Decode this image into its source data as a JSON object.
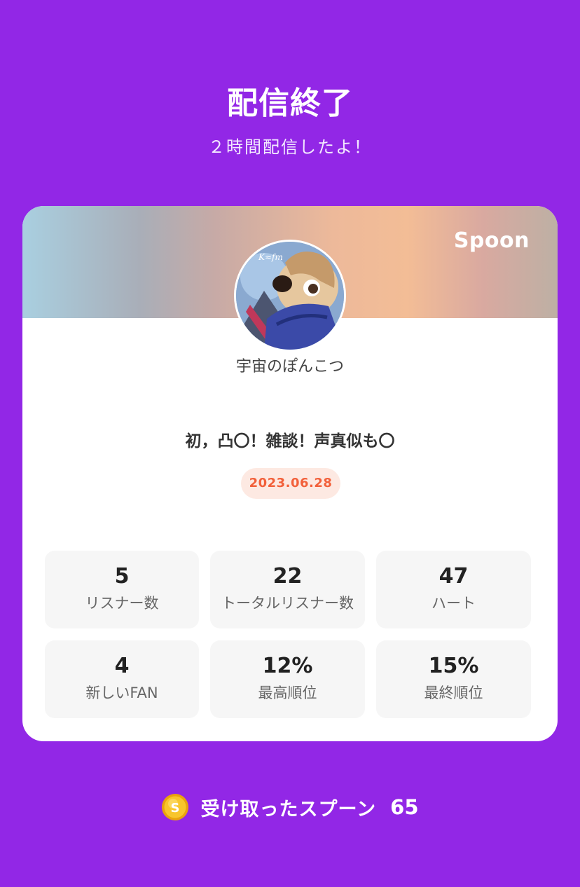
{
  "header": {
    "title": "配信終了",
    "subtitle": "２時間配信したよ！"
  },
  "card": {
    "brand": "Spoon",
    "username": "宇宙のぽんこつ",
    "stream_title": "初，凸〇！雑談！声真似も〇",
    "date": "2023.06.28",
    "stats": [
      {
        "value": "5",
        "label": "リスナー数"
      },
      {
        "value": "22",
        "label": "トータルリスナー数"
      },
      {
        "value": "47",
        "label": "ハート"
      },
      {
        "value": "4",
        "label": "新しいFAN"
      },
      {
        "value": "12%",
        "label": "最高順位"
      },
      {
        "value": "15%",
        "label": "最終順位"
      }
    ]
  },
  "footer": {
    "label": "受け取ったスプーン",
    "count": "65",
    "icon": "spoon-coin-icon"
  },
  "colors": {
    "background": "#9227e6",
    "badge_text": "#f2603a",
    "badge_bg": "#fde9e2",
    "stat_bg": "#f6f6f6",
    "coin": "#f6b820"
  }
}
